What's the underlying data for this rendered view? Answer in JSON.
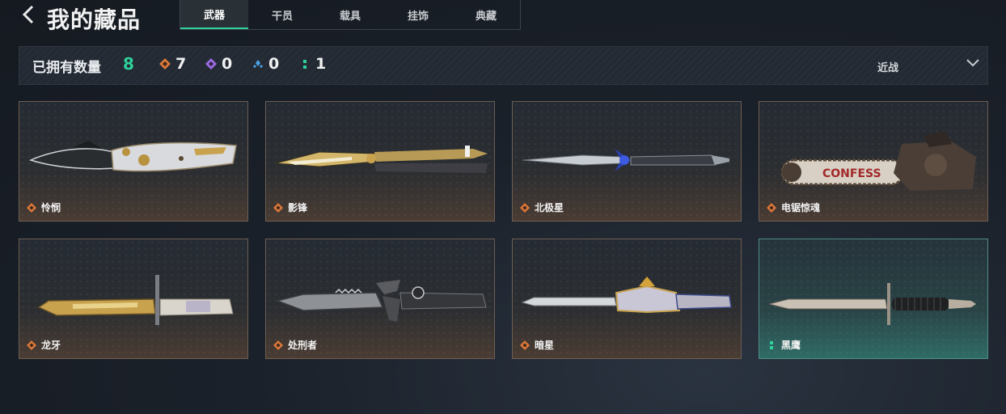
{
  "header": {
    "back_icon": "chevron-left-icon",
    "title": "我的藏品",
    "tabs": [
      {
        "label": "武器",
        "active": true
      },
      {
        "label": "干员",
        "active": false
      },
      {
        "label": "载具",
        "active": false
      },
      {
        "label": "挂饰",
        "active": false
      },
      {
        "label": "典藏",
        "active": false
      }
    ]
  },
  "stats": {
    "owned_label": "已拥有数量",
    "owned_count": "8",
    "counts": [
      {
        "icon": "orange-diamond-icon",
        "color": "#d9773a",
        "value": "7"
      },
      {
        "icon": "purple-diamond-icon",
        "color": "#9b6be0",
        "value": "0"
      },
      {
        "icon": "blue-diamond-icon",
        "color": "#4aa3e6",
        "value": "0"
      },
      {
        "icon": "green-dots-icon",
        "color": "#2fd19b",
        "value": "1"
      }
    ],
    "filter_label": "近战",
    "filter_icon": "chevron-down-icon"
  },
  "colors": {
    "accent": "#2fd19b",
    "rarity_orange": "#d9773a",
    "rarity_green": "#2fd19b"
  },
  "items": [
    {
      "name": "怜悯",
      "rarity": "orange"
    },
    {
      "name": "影锋",
      "rarity": "orange"
    },
    {
      "name": "北极星",
      "rarity": "orange"
    },
    {
      "name": "电锯惊魂",
      "rarity": "orange"
    },
    {
      "name": "龙牙",
      "rarity": "orange"
    },
    {
      "name": "处刑者",
      "rarity": "orange"
    },
    {
      "name": "暗星",
      "rarity": "orange"
    },
    {
      "name": "黑鹰",
      "rarity": "green"
    }
  ],
  "chainsaw_text": "CONFESS"
}
